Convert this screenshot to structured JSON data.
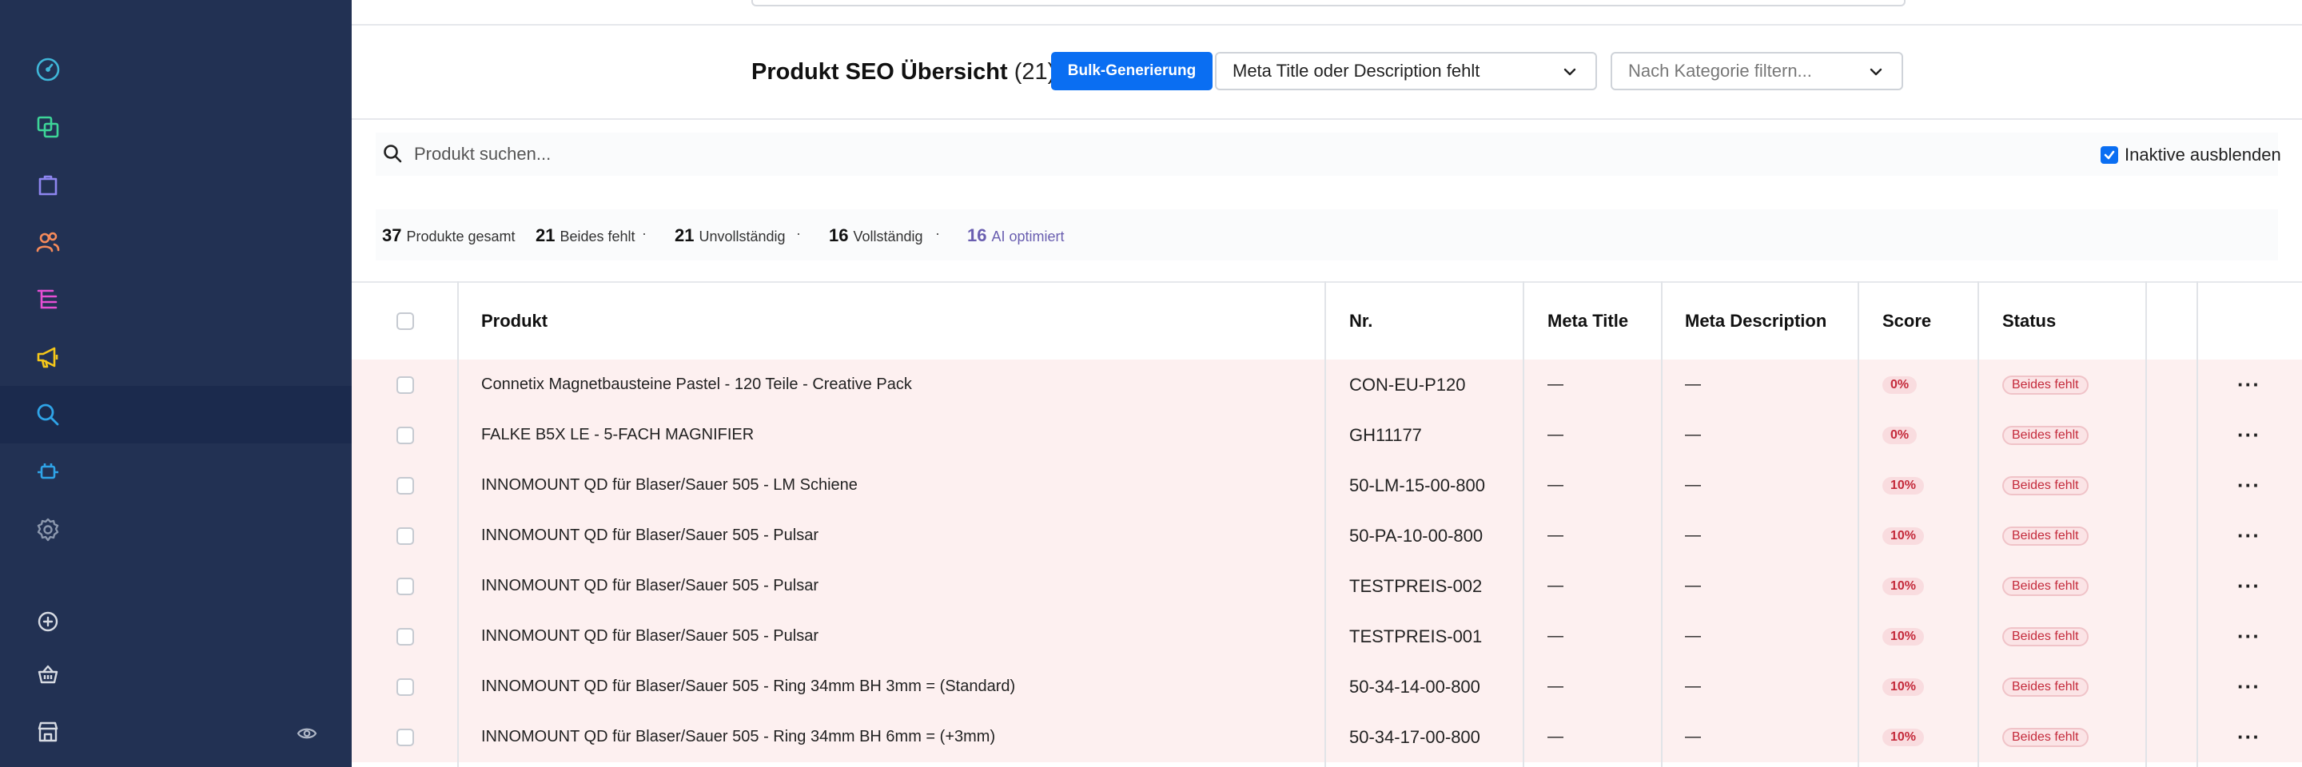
{
  "sidebar": {
    "items": [
      {
        "icon": "dashboard-gauge-icon",
        "color": "#3fb6d8"
      },
      {
        "icon": "copy-icon",
        "color": "#3dd598"
      },
      {
        "icon": "shopping-bag-icon",
        "color": "#8e86f0"
      },
      {
        "icon": "users-icon",
        "color": "#f58a5a"
      },
      {
        "icon": "list-tree-icon",
        "color": "#e64fd4"
      },
      {
        "icon": "megaphone-icon",
        "color": "#f5c71a"
      },
      {
        "icon": "search-icon",
        "color": "#2fa4e8",
        "active": true
      },
      {
        "icon": "plugin-icon",
        "color": "#2fa4e8"
      },
      {
        "icon": "gear-icon",
        "color": "#8b97ad"
      }
    ],
    "bottom": [
      {
        "icon": "plus-circle-icon"
      },
      {
        "icon": "basket-icon"
      },
      {
        "icon": "store-icon"
      }
    ]
  },
  "header": {
    "title": "Produkt SEO Übersicht",
    "count": "(21)",
    "bulk_button": "Bulk-Generierung",
    "filter_select": "Meta Title oder Description fehlt",
    "category_select": "Nach Kategorie filtern..."
  },
  "search": {
    "placeholder": "Produkt suchen...",
    "hide_inactive_label": "Inaktive ausblenden",
    "hide_inactive_checked": true
  },
  "stats": [
    {
      "value": "37",
      "label": "Produkte gesamt"
    },
    {
      "value": "21",
      "label": "Beides fehlt"
    },
    {
      "value": "21",
      "label": "Unvollständig"
    },
    {
      "value": "16",
      "label": "Vollständig"
    },
    {
      "value": "16",
      "label": "AI optimiert"
    }
  ],
  "stats_separator": "·",
  "table": {
    "columns": {
      "produkt": "Produkt",
      "nr": "Nr.",
      "meta_title": "Meta Title",
      "meta_description": "Meta Description",
      "score": "Score",
      "status": "Status"
    },
    "rows": [
      {
        "produkt": "Connetix Magnetbausteine Pastel - 120 Teile - Creative Pack",
        "nr": "CON-EU-P120",
        "meta_title": "—",
        "meta_description": "—",
        "score": "0%",
        "status": "Beides fehlt",
        "actions": "···"
      },
      {
        "produkt": "FALKE B5X LE - 5-FACH MAGNIFIER",
        "nr": "GH11177",
        "meta_title": "—",
        "meta_description": "—",
        "score": "0%",
        "status": "Beides fehlt",
        "actions": "···"
      },
      {
        "produkt": "INNOMOUNT QD für Blaser/Sauer 505 - LM Schiene",
        "nr": "50-LM-15-00-800",
        "meta_title": "—",
        "meta_description": "—",
        "score": "10%",
        "status": "Beides fehlt",
        "actions": "···"
      },
      {
        "produkt": "INNOMOUNT QD für Blaser/Sauer 505 - Pulsar",
        "nr": "50-PA-10-00-800",
        "meta_title": "—",
        "meta_description": "—",
        "score": "10%",
        "status": "Beides fehlt",
        "actions": "···"
      },
      {
        "produkt": "INNOMOUNT QD für Blaser/Sauer 505 - Pulsar",
        "nr": "TESTPREIS-002",
        "meta_title": "—",
        "meta_description": "—",
        "score": "10%",
        "status": "Beides fehlt",
        "actions": "···"
      },
      {
        "produkt": "INNOMOUNT QD für Blaser/Sauer 505 - Pulsar",
        "nr": "TESTPREIS-001",
        "meta_title": "—",
        "meta_description": "—",
        "score": "10%",
        "status": "Beides fehlt",
        "actions": "···"
      },
      {
        "produkt": "INNOMOUNT QD für Blaser/Sauer 505 - Ring 34mm BH 3mm = (Standard)",
        "nr": "50-34-14-00-800",
        "meta_title": "—",
        "meta_description": "—",
        "score": "10%",
        "status": "Beides fehlt",
        "actions": "···"
      },
      {
        "produkt": "INNOMOUNT QD für Blaser/Sauer 505 - Ring 34mm BH 6mm = (+3mm)",
        "nr": "50-34-17-00-800",
        "meta_title": "—",
        "meta_description": "—",
        "score": "10%",
        "status": "Beides fehlt",
        "actions": "···"
      }
    ]
  }
}
